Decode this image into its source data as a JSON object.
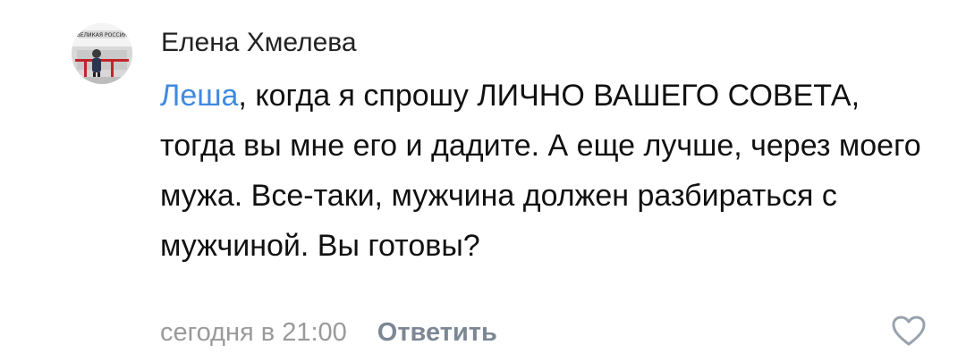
{
  "comment": {
    "author": "Елена Хмелева",
    "avatar_caption": "ВЕЛИКАЯ РОССИЯ",
    "mention": "Леша",
    "text": ", когда я спрошу ЛИЧНО ВАШЕГО СОВЕТА, тогда вы мне его и дадите. А еще лучше, через моего мужа. Все-таки, мужчина должен разбираться с мужчиной. Вы готовы?",
    "timestamp": "сегодня в 21:00",
    "reply_label": "Ответить",
    "like_icon": "heart-outline-icon"
  },
  "colors": {
    "mention": "#3f8ae0",
    "meta": "#9a9a9a",
    "reply": "#7c8793",
    "like_icon": "#99a2ad"
  }
}
